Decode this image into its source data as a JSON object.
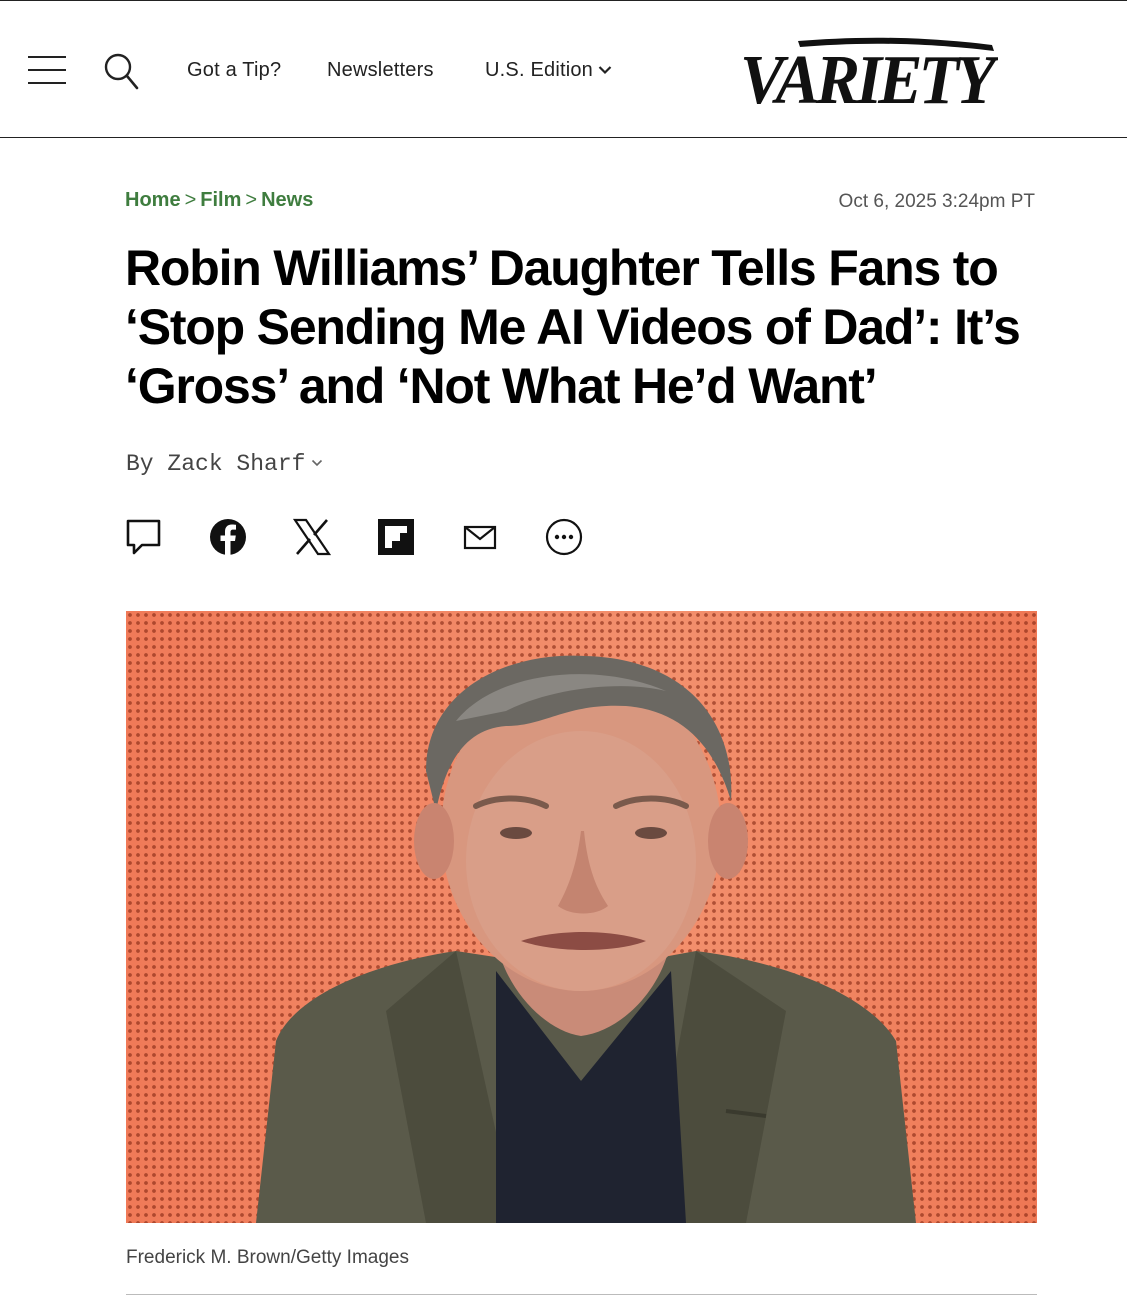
{
  "header": {
    "nav": {
      "tip": "Got a Tip?",
      "newsletters": "Newsletters",
      "edition": "U.S. Edition"
    },
    "logo_text": "VARIETY"
  },
  "article": {
    "breadcrumb": [
      "Home",
      "Film",
      "News"
    ],
    "breadcrumb_separator": ">",
    "timestamp": "Oct 6, 2025 3:24pm PT",
    "headline": "Robin Williams’ Daughter Tells Fans to ‘Stop Sending Me AI Videos of Dad’: It’s ‘Gross’ and ‘Not What He’d Want’",
    "byline_prefix": "By",
    "author": "Zack Sharf",
    "share_icons": [
      "comment-icon",
      "facebook-icon",
      "x-icon",
      "flipboard-icon",
      "email-icon",
      "more-icon"
    ],
    "photo_caption": "Frederick M. Brown/Getty Images"
  },
  "colors": {
    "breadcrumb_green": "#3f7d3f",
    "hero_background": "#ef7d5c"
  }
}
